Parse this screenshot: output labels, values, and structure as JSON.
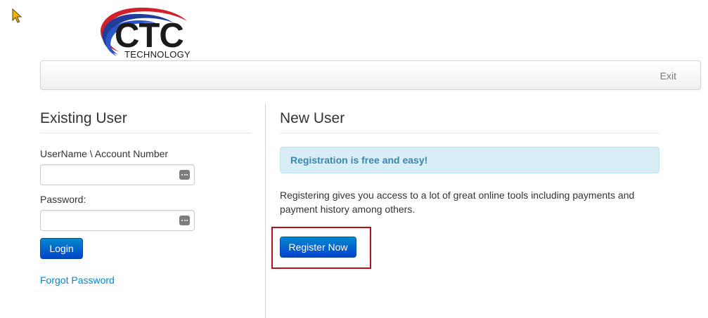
{
  "logo": {
    "brand": "CTC",
    "tagline": "TECHNOLOGY",
    "colors": {
      "blue": "#1f3d99",
      "red": "#d0202a",
      "ink": "#1a1a1a"
    }
  },
  "navbar": {
    "exit_label": "Exit"
  },
  "existing_user": {
    "heading": "Existing User",
    "username_label": "UserName \\ Account Number",
    "username_value": "",
    "password_label": "Password:",
    "password_value": "",
    "login_label": "Login",
    "forgot_label": "Forgot Password"
  },
  "new_user": {
    "heading": "New User",
    "alert_text": "Registration is free and easy!",
    "description": "Registering gives you access to a lot of great online tools including payments and payment history among others.",
    "register_label": "Register Now"
  },
  "colors": {
    "primary": "#0088cc",
    "alert_bg": "#d9edf7",
    "alert_text": "#3a87ad",
    "highlight": "#b3121c"
  },
  "icons": {
    "field_icon": "keypad-icon",
    "cursor": "mouse-pointer-icon"
  }
}
